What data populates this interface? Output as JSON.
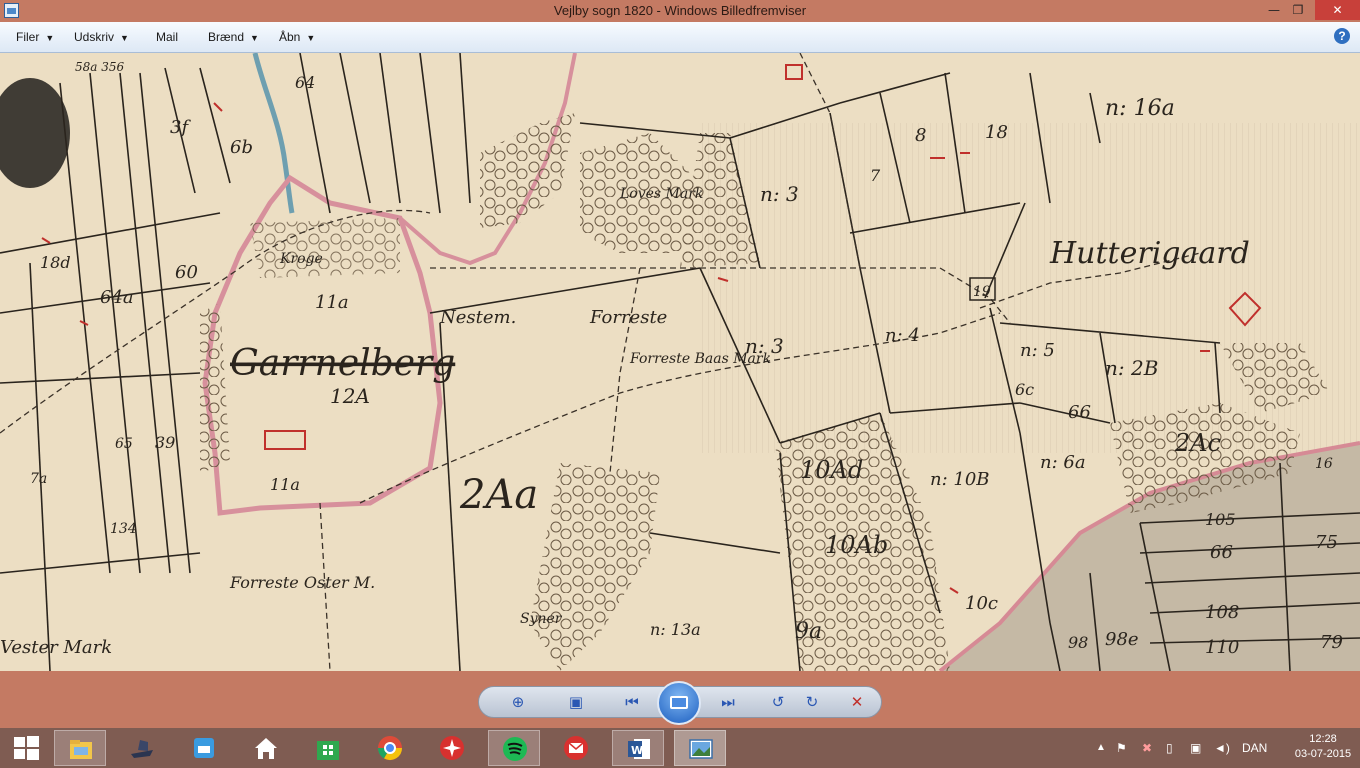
{
  "window": {
    "title": "Vejlby sogn 1820 - Windows Billedfremviser",
    "minimize_glyph": "—",
    "maximize_glyph": "❐",
    "close_glyph": "✕"
  },
  "menu": {
    "items": [
      {
        "label": "Filer",
        "has_dropdown": true
      },
      {
        "label": "Udskriv",
        "has_dropdown": true
      },
      {
        "label": "Mail",
        "has_dropdown": false
      },
      {
        "label": "Brænd",
        "has_dropdown": true
      },
      {
        "label": "Åbn",
        "has_dropdown": true
      }
    ],
    "help_glyph": "?"
  },
  "map": {
    "labels": {
      "huttrigaard": "Hutterigaard",
      "garrnelberg": "Garrnelberg",
      "aa2": "2Aa",
      "lowes_mark": "Loves Mark",
      "forreste_baas_mark": "Forreste Baas Mark",
      "nestem": "Nestem.",
      "forreste": "Forreste",
      "forreste_oster_m": "Forreste Oster M.",
      "vester_mark": "Vester Mark",
      "syner": "Syner",
      "kroge": "Kroge",
      "n3a": "n: 3",
      "n3b": "n: 3",
      "n4": "n: 4",
      "n5": "n: 5",
      "n2B": "n: 2B",
      "n6a": "n: 6a",
      "n10B": "n: 10B",
      "n16a": "n: 16a",
      "n13a": "n: 13a",
      "p10Ad": "10Ad",
      "p10Ab": "10Ab",
      "p2Ac": "2Ac",
      "p11a": "11a",
      "p11a2": "11a",
      "p12A": "12A",
      "p60": "60",
      "p64a": "64a",
      "p18d": "18d",
      "p39": "39",
      "p65": "65",
      "p134": "134",
      "p64": "64",
      "p66": "66",
      "p105": "105",
      "p108": "108",
      "p110": "110",
      "p79": "79",
      "p75": "75",
      "p16": "16",
      "p18": "18",
      "p8": "8",
      "p7": "7",
      "p19": "19",
      "p9a": "9a",
      "p10c": "10c",
      "p98": "98",
      "p98e": "98e",
      "p3f": "3f",
      "p6b": "6b",
      "p58a": "58a 356",
      "p74": "7a",
      "p6c": "6c",
      "p60b": "66"
    }
  },
  "controls": {
    "zoom_glyph": "⊕",
    "fit_glyph": "▣",
    "prev_glyph": "⏮",
    "next_glyph": "⏭",
    "rotate_ccw_glyph": "↺",
    "rotate_cw_glyph": "↻",
    "delete_glyph": "✕"
  },
  "taskbar": {
    "language": "DAN",
    "time": "12:28",
    "date": "03-07-2015"
  }
}
